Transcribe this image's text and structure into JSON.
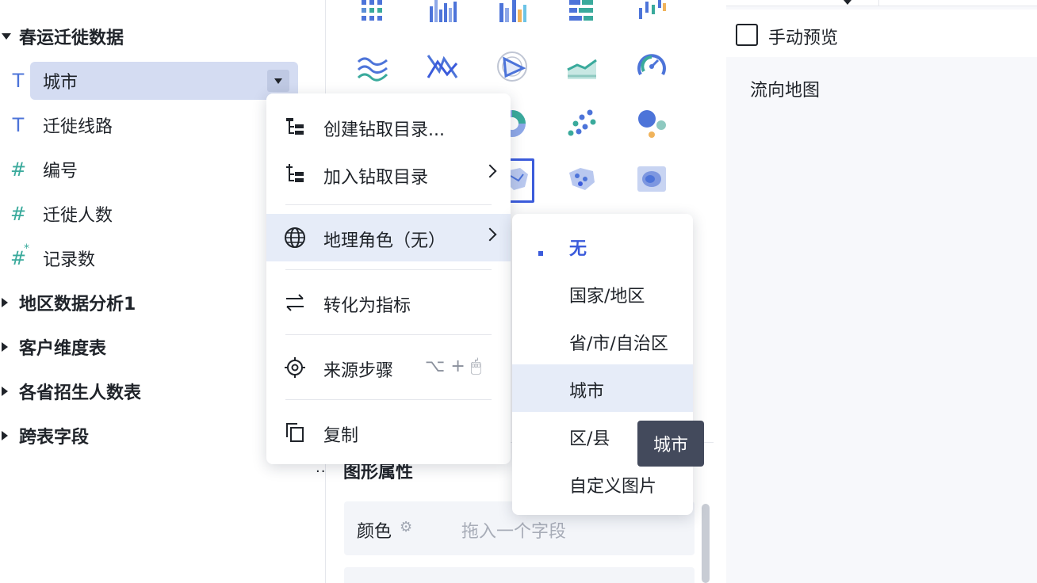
{
  "field_tree": {
    "expanded_group": "春运迁徙数据",
    "fields": [
      {
        "label": "城市",
        "type": "text"
      },
      {
        "label": "迁徙线路",
        "type": "text"
      },
      {
        "label": "编号",
        "type": "number"
      },
      {
        "label": "迁徙人数",
        "type": "number"
      },
      {
        "label": "记录数",
        "type": "number-calculated"
      }
    ],
    "collapsed_groups": [
      "地区数据分析1",
      "客户维度表",
      "各省招生人数表",
      "跨表字段"
    ],
    "type_icons": {
      "text": "T",
      "number": "#",
      "star": "*"
    }
  },
  "context_menu": {
    "items": [
      {
        "label": "创建钻取目录...",
        "icon": "drill-create-icon"
      },
      {
        "label": "加入钻取目录",
        "icon": "drill-add-icon"
      },
      {
        "label": "地理角色（无）",
        "icon": "globe-icon"
      },
      {
        "label": "转化为指标",
        "icon": "swap-icon"
      },
      {
        "label": "来源步骤",
        "icon": "target-icon",
        "shortcut": "⌥ + 🖱"
      },
      {
        "label": "复制",
        "icon": "copy-icon"
      }
    ]
  },
  "geo_submenu": {
    "items": [
      "无",
      "国家/地区",
      "省/市/自治区",
      "城市",
      "区/县",
      "自定义图片"
    ],
    "selected": "无",
    "hovered": "城市"
  },
  "tooltip": "城市",
  "chart_panel": {
    "section_title": "图形属性",
    "drag_handle": "⁚⁚",
    "color_label": "颜色",
    "color_placeholder": "拖入一个字段"
  },
  "preview_panel": {
    "manual_preview_label": "手动预览",
    "manual_preview_checked": false,
    "chart_title": "流向地图"
  },
  "colors": {
    "accent": "#3b5bdb",
    "highlight_bg": "#d4dcf2",
    "menu_hover": "#e6ecf8",
    "text_field_icon": "#4d74d9",
    "number_field_icon": "#3aaa9c",
    "tooltip_bg": "#434a5c"
  }
}
